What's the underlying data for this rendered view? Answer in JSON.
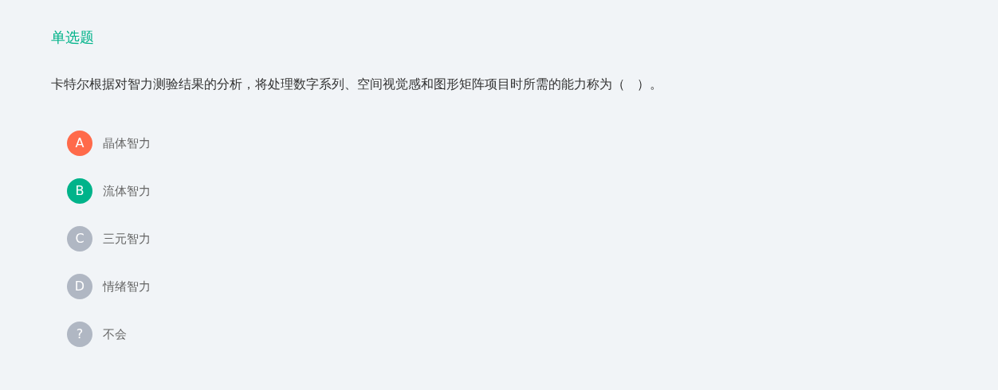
{
  "question_type": "单选题",
  "question": "卡特尔根据对智力测验结果的分析，将处理数字系列、空间视觉感和图形矩阵项目时所需的能力称为（   ）。",
  "options": [
    {
      "letter": "A",
      "text": "晶体智力",
      "color": "#ff6a4a"
    },
    {
      "letter": "B",
      "text": "流体智力",
      "color": "#00b38a"
    },
    {
      "letter": "C",
      "text": "三元智力",
      "color": "#b0b7c3"
    },
    {
      "letter": "D",
      "text": "情绪智力",
      "color": "#b0b7c3"
    },
    {
      "letter": "?",
      "text": "不会",
      "color": "#b0b7c3"
    }
  ]
}
